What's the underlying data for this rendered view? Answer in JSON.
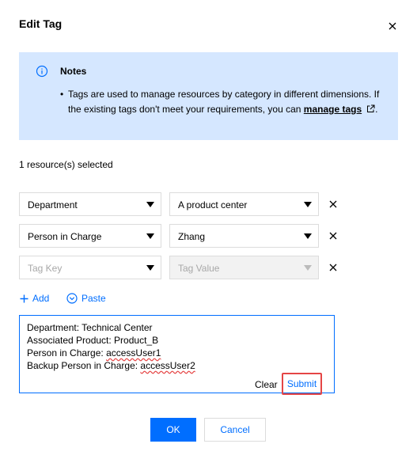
{
  "dialog": {
    "title": "Edit Tag"
  },
  "notes": {
    "title": "Notes",
    "bullet": "•",
    "body_prefix": "Tags are used to manage resources by category in different dimensions. If the existing tags don't meet your requirements, you can ",
    "link_label": "manage tags",
    "body_suffix": "."
  },
  "selection": {
    "count_text": "1 resource(s) selected"
  },
  "tag_rows": [
    {
      "key": "Department",
      "value": "A product center"
    },
    {
      "key": "Person in Charge",
      "value": "Zhang"
    },
    {
      "key_placeholder": "Tag Key",
      "value_placeholder": "Tag Value"
    }
  ],
  "actions": {
    "add_label": "Add",
    "paste_label": "Paste"
  },
  "paste_box": {
    "lines": [
      {
        "text": "Department: Technical Center"
      },
      {
        "text": "Associated Product: Product_B"
      },
      {
        "prefix": "Person in Charge: ",
        "flagged": "accessUser1"
      },
      {
        "prefix": "Backup Person in Charge: ",
        "flagged": "accessUser2"
      }
    ],
    "clear_label": "Clear",
    "submit_label": "Submit"
  },
  "footer": {
    "ok_label": "OK",
    "cancel_label": "Cancel"
  },
  "colors": {
    "accent": "#006eff",
    "notes_bg": "#d5e7ff",
    "highlight": "#e54545"
  }
}
